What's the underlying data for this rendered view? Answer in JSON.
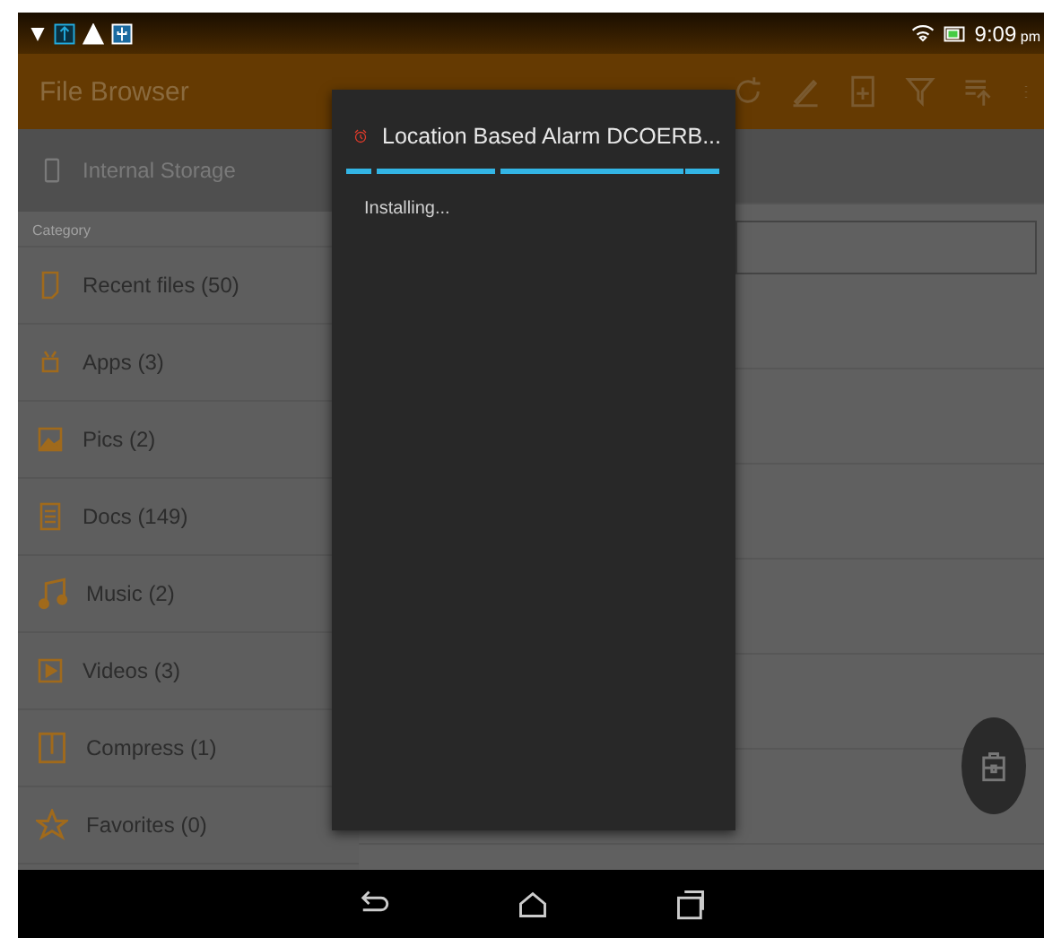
{
  "status_bar": {
    "time": "9:09",
    "period": "pm"
  },
  "app_bar": {
    "title": "File Browser"
  },
  "sidebar": {
    "storage": "Internal Storage",
    "category_header": "Category",
    "items": [
      {
        "kind": "recent",
        "label": "Recent files",
        "count": "(50)"
      },
      {
        "kind": "apps",
        "label": "Apps",
        "count": "(3)"
      },
      {
        "kind": "pics",
        "label": "Pics",
        "count": "(2)"
      },
      {
        "kind": "docs",
        "label": "Docs",
        "count": "(149)"
      },
      {
        "kind": "music",
        "label": "Music",
        "count": "(2)"
      },
      {
        "kind": "videos",
        "label": "Videos",
        "count": "(3)"
      },
      {
        "kind": "compress",
        "label": "Compress",
        "count": "(1)"
      },
      {
        "kind": "favorites",
        "label": "Favorites",
        "count": "(0)"
      }
    ]
  },
  "dialog": {
    "title": "Location Based Alarm DCOERB...",
    "message": "Installing..."
  }
}
